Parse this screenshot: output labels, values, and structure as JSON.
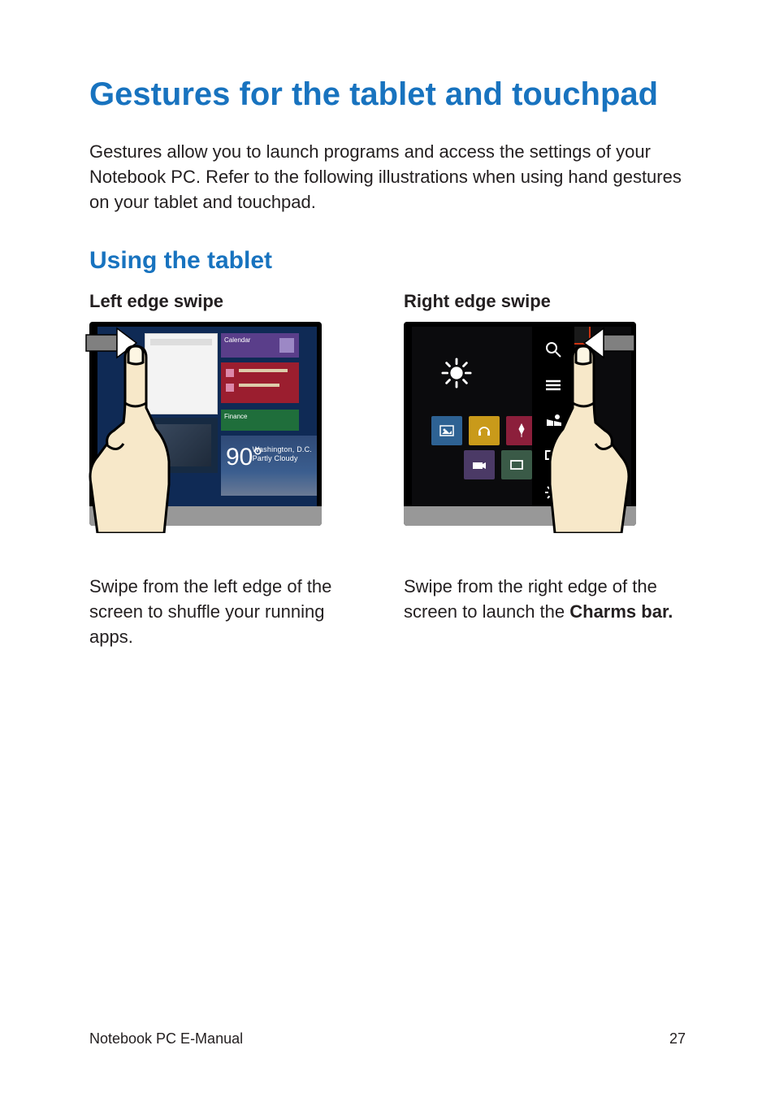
{
  "page": {
    "title": "Gestures for the tablet and touchpad",
    "intro": "Gestures allow you to launch programs and access the settings of your Notebook PC. Refer to the following illustrations when using hand gestures on your tablet and touchpad.",
    "section_title": "Using the tablet"
  },
  "left": {
    "title": "Left edge swipe",
    "desc": "Swipe from the left edge of the screen to shuffle your running apps.",
    "weather_temp": "90°",
    "weather_loc": "Washington, D.C.",
    "weather_cond": "Partly Cloudy",
    "tile_calendar": "Calendar",
    "tile_finance": "Finance"
  },
  "right": {
    "title": "Right edge swipe",
    "desc_prefix": "Swipe from the right edge of the screen to launch the ",
    "desc_bold": "Charms bar."
  },
  "footer": {
    "doc": "Notebook PC E-Manual",
    "page_num": "27"
  }
}
